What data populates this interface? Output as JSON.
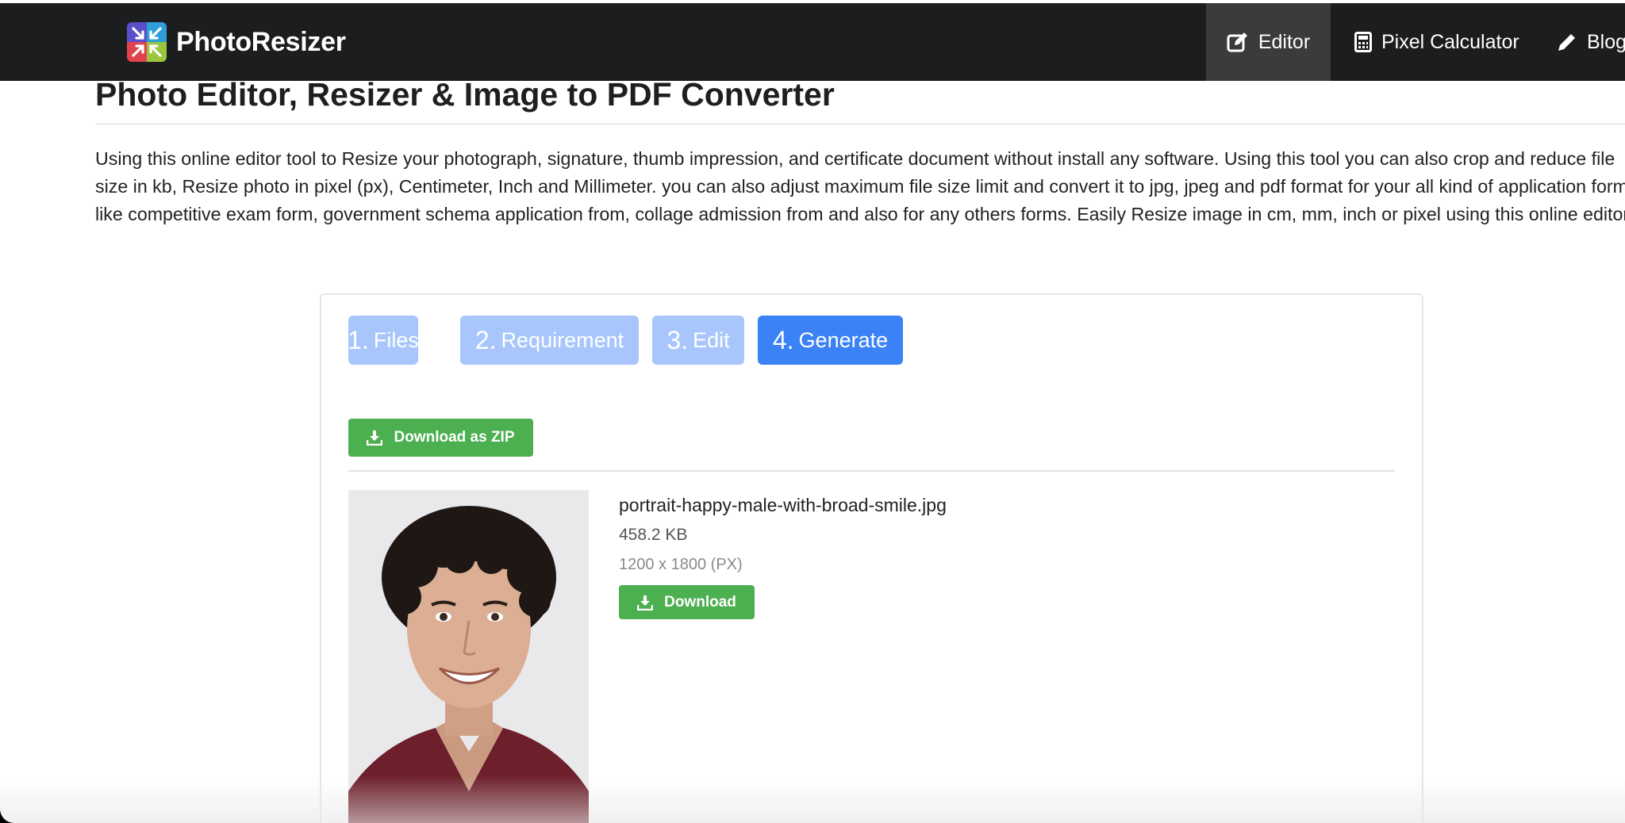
{
  "brand": {
    "name": "PhotoResizer",
    "logo": "photoresizer-logo"
  },
  "nav": {
    "items": [
      {
        "label": "Editor",
        "icon": "edit-icon",
        "active": true
      },
      {
        "label": "Pixel Calculator",
        "icon": "calculator-icon",
        "active": false
      },
      {
        "label": "Blog",
        "icon": "pencil-icon",
        "active": false
      }
    ]
  },
  "page": {
    "title": "Photo Editor, Resizer & Image to PDF Converter",
    "intro": "Using this online editor tool to Resize your photograph, signature, thumb impression, and certificate document without install any software. Using this tool you can also crop and reduce file size in kb, Resize photo in pixel (px), Centimeter, Inch and Millimeter. you can also adjust maximum file size limit and convert it to jpg, jpeg and pdf format for your all kind of application form like competitive exam form, government schema application from, collage admission from and also for any others forms. Easily Resize image in cm, mm, inch or pixel using this online editor."
  },
  "steps": [
    {
      "num": "1.",
      "label": "Files",
      "active": false
    },
    {
      "num": "2.",
      "label": "Requirement",
      "active": false
    },
    {
      "num": "3.",
      "label": "Edit",
      "active": false
    },
    {
      "num": "4.",
      "label": "Generate",
      "active": true
    }
  ],
  "actions": {
    "zip_label": "Download as ZIP",
    "download_label": "Download"
  },
  "file": {
    "name": "portrait-happy-male-with-broad-smile.jpg",
    "size": "458.2 KB",
    "dimensions": "1200 x 1800 (PX)"
  },
  "colors": {
    "navbar": "#1c1d1f",
    "nav_active": "#3a3b3d",
    "step_active": "#3b82f6",
    "step_inactive": "#a8c6fb",
    "download_green": "#4caf50"
  }
}
